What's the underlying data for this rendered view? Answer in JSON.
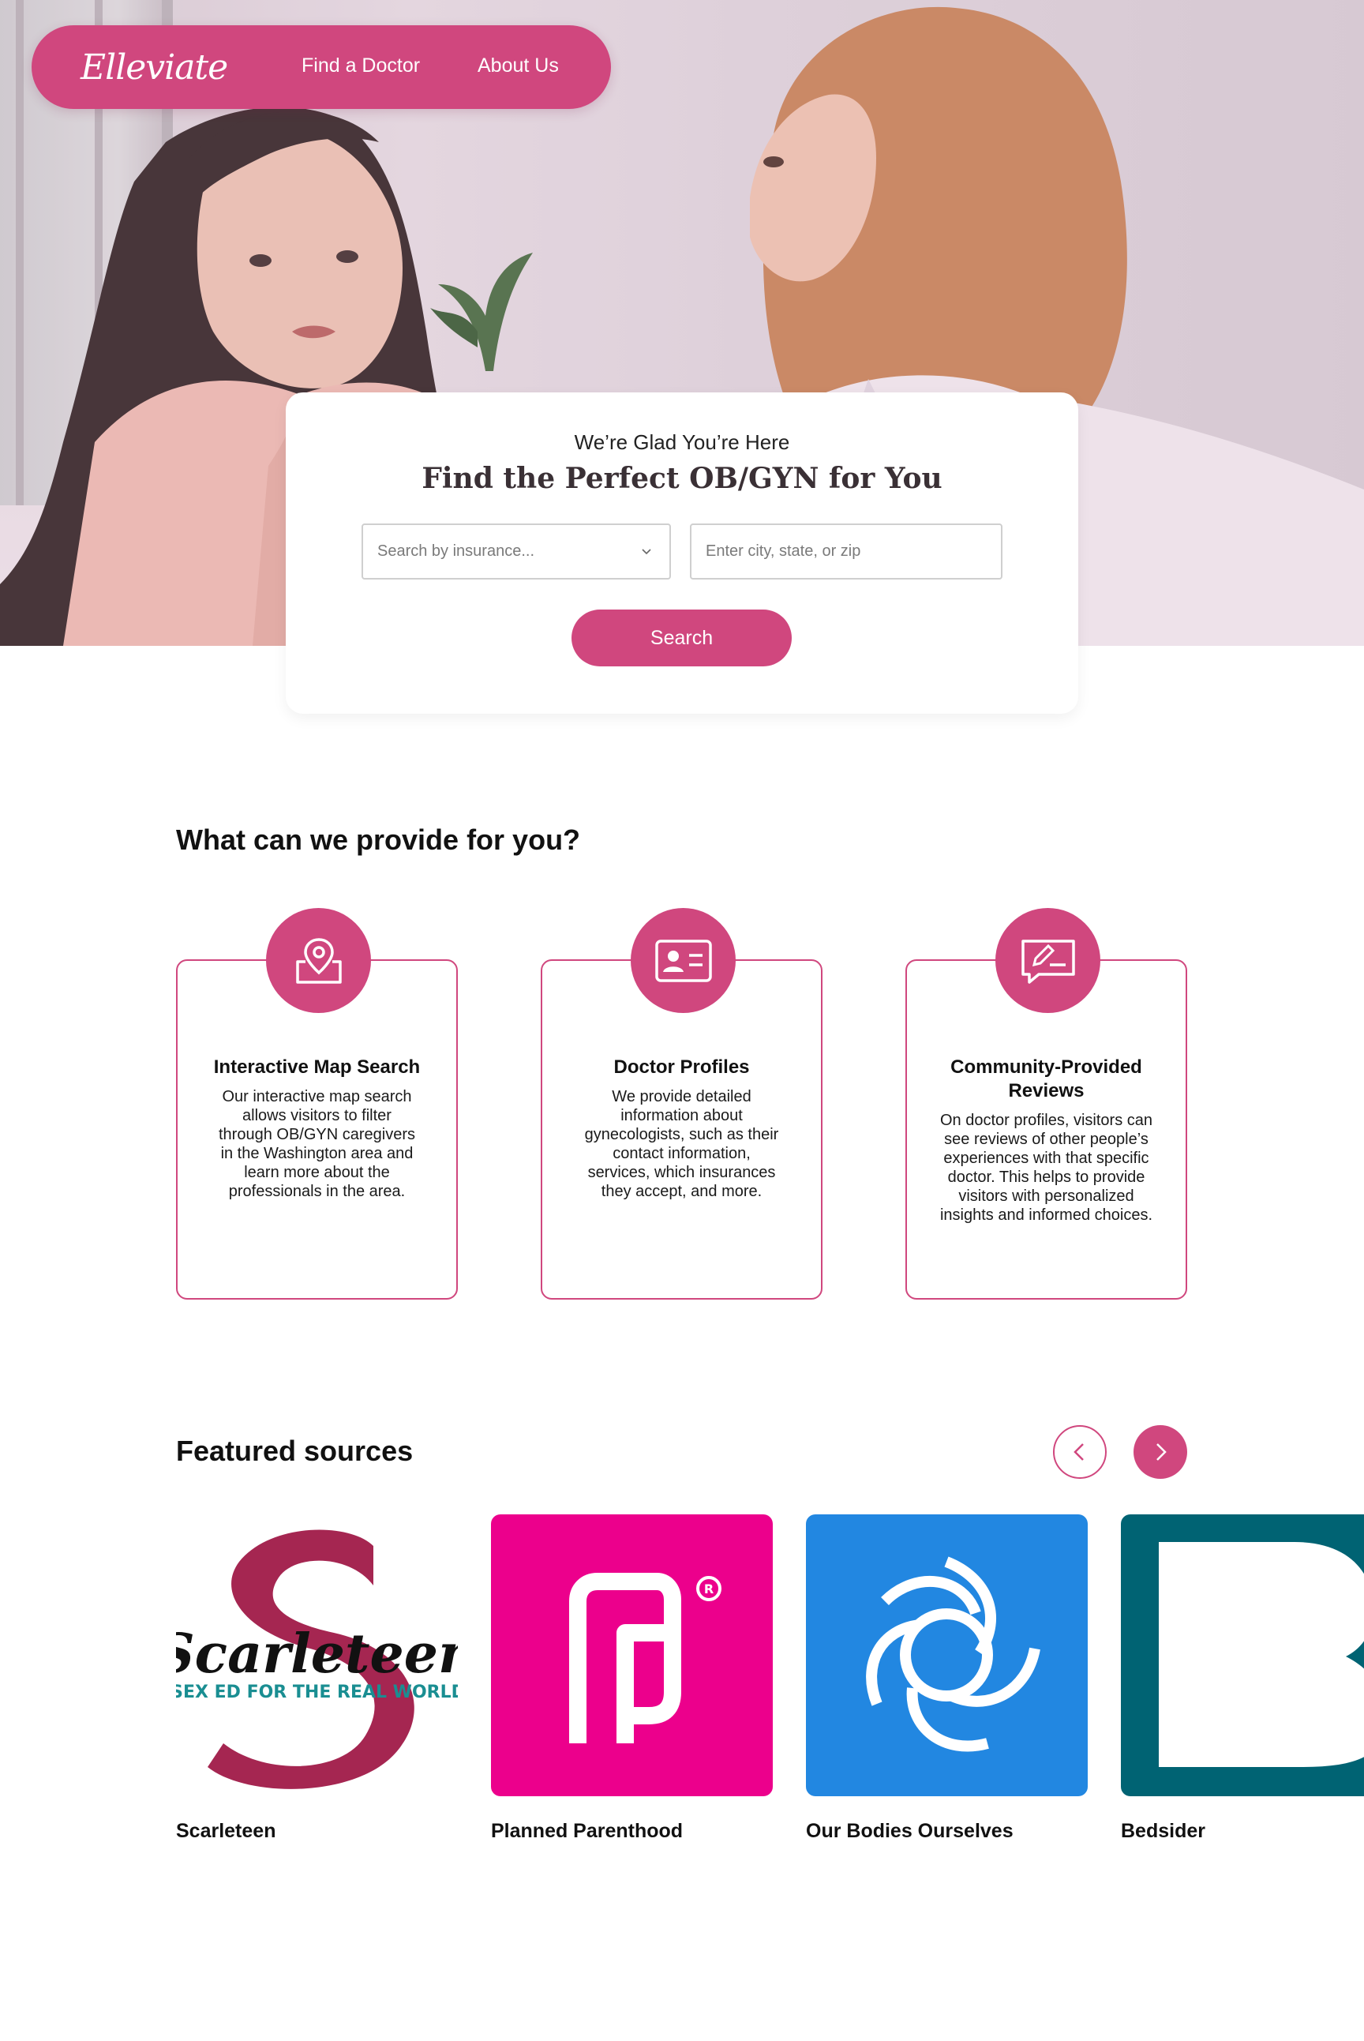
{
  "nav": {
    "logo": "Elleviate",
    "links": [
      "Find a Doctor",
      "About Us"
    ]
  },
  "search": {
    "kicker": "We’re Glad You’re Here",
    "headline": "Find the Perfect OB/GYN for You",
    "insurance_placeholder": "Search by insurance...",
    "location_placeholder": "Enter city, state, or zip",
    "button": "Search"
  },
  "provide": {
    "title": "What can we provide for you?",
    "features": [
      {
        "icon": "map-pin-icon",
        "title": "Interactive Map Search",
        "desc": "Our interactive map search allows visitors to filter through OB/GYN caregivers in the Washington area and learn more about the professionals in the area."
      },
      {
        "icon": "id-card-icon",
        "title": "Doctor Profiles",
        "desc": "We provide detailed information about gynecologists, such as their contact information, services, which insurances they accept, and more."
      },
      {
        "icon": "review-edit-icon",
        "title": "Community-Provided Reviews",
        "desc": "On doctor profiles, visitors can see reviews of other people’s experiences with that specific doctor. This helps to provide visitors with personalized insights and informed choices."
      }
    ]
  },
  "featured": {
    "title": "Featured sources",
    "sources": [
      {
        "name": "Scarleteen",
        "logo_text": "Scarleteen",
        "tagline": "SEX ED FOR THE REAL WORLD",
        "color": "#a01a48"
      },
      {
        "name": "Planned Parenthood",
        "color": "#ec008c"
      },
      {
        "name": "Our Bodies Ourselves",
        "color": "#2287e1"
      },
      {
        "name": "Bedsider",
        "color": "#006373"
      }
    ]
  },
  "colors": {
    "accent": "#d0477e"
  }
}
